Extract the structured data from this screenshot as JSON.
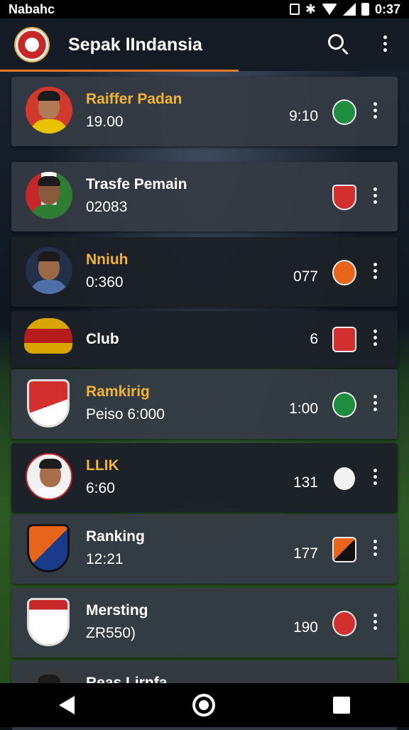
{
  "status": {
    "left_text": "Nabahc",
    "right_text": "0:37"
  },
  "appbar": {
    "title": "Sepak lIndansia"
  },
  "rows": [
    {
      "name": "Raiffer Padan",
      "sub": "19.00",
      "value": "9:10",
      "name_color": "gold",
      "badge_color": "#1e8e3e",
      "card_style": "light"
    },
    {
      "name": "Trasfe Pemain",
      "sub": "02083",
      "value": "",
      "name_color": "white",
      "badge_color": "#d32f2f",
      "card_style": "light"
    },
    {
      "name": "Nniuh",
      "sub": "0:360",
      "value": "077",
      "name_color": "gold",
      "badge_color": "#e8641b",
      "card_style": "dark"
    },
    {
      "name": "Club",
      "sub": "",
      "value": "6",
      "name_color": "white",
      "badge_color": "#d32f2f",
      "card_style": "dark"
    },
    {
      "name": "Ramkirig",
      "sub": "Peiso 6:000",
      "value": "1:00",
      "name_color": "gold",
      "badge_color": "#1e8e3e",
      "card_style": "light"
    },
    {
      "name": "LLIK",
      "sub": "6:60",
      "value": "131",
      "name_color": "gold",
      "badge_color": "#f2f2f2",
      "card_style": "dark"
    },
    {
      "name": "Ranking",
      "sub": "12:21",
      "value": "177",
      "name_color": "white",
      "badge_color": "#e8641b",
      "card_style": "light"
    },
    {
      "name": "Mersting",
      "sub": "ZR550)",
      "value": "190",
      "name_color": "white",
      "badge_color": "#d32f2f",
      "card_style": "light"
    },
    {
      "name": "Reas Lirnfa",
      "sub": "",
      "value": "",
      "name_color": "white",
      "badge_color": "#e8641b",
      "card_style": "light"
    }
  ]
}
